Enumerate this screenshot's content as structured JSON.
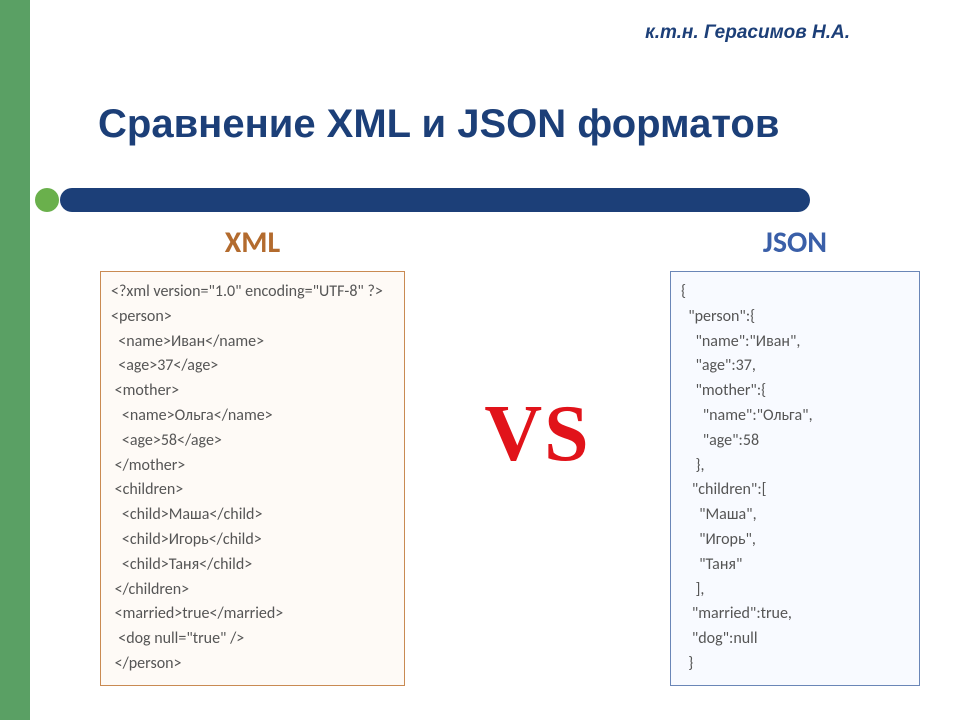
{
  "author": "к.т.н. Герасимов Н.А.",
  "title": "Сравнение XML и JSON форматов",
  "labels": {
    "xml": "XML",
    "json": "JSON",
    "vs": "VS"
  },
  "xml_code": "<?xml version=\"1.0\" encoding=\"UTF-8\" ?>\n<person>\n  <name>Иван</name>\n  <age>37</age>\n <mother>\n   <name>Ольга</name>\n   <age>58</age>\n </mother>\n <children>\n   <child>Маша</child>\n   <child>Игорь</child>\n   <child>Таня</child>\n </children>\n <married>true</married>\n  <dog null=\"true\" />\n </person>",
  "json_code": "{\n  \"person\":{\n    \"name\":\"Иван\",\n    \"age\":37,\n    \"mother\":{\n      \"name\":\"Ольга\",\n      \"age\":58\n    },\n   \"children\":[\n     \"Маша\",\n     \"Игорь\",\n     \"Таня\"\n    ],\n   \"married\":true,\n   \"dog\":null\n  }"
}
